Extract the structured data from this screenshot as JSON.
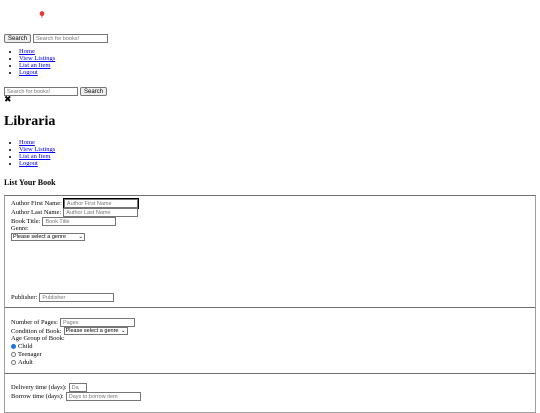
{
  "header": {
    "search_button": "Search",
    "search_placeholder": "Search for books!"
  },
  "nav": {
    "home": "Home",
    "view_listings": "View Listings",
    "list_item": "List an Item",
    "logout": "Logout"
  },
  "brand": "Libraria",
  "form": {
    "title": "List Your Book",
    "author_first_label": "Author First Name:",
    "author_first_placeholder": "Author First Name",
    "author_last_label": "Author Last Name:",
    "author_last_placeholder": "Author Last Name",
    "book_title_label": "Book Title:",
    "book_title_placeholder": "Book Title",
    "genre_label": "Genre:",
    "genre_selected": "Please select a genre",
    "publisher_label": "Publisher:",
    "publisher_placeholder": "Publisher",
    "pages_label": "Number of Pages:",
    "pages_placeholder": "Pages",
    "condition_label": "Condition of Book:",
    "condition_selected": "Please select a genre",
    "age_group_label": "Age Group of Book:",
    "age_groups": [
      "Child",
      "Teenager",
      "Adult"
    ],
    "age_group_selected": "Child",
    "delivery_label": "Delivery time (days):",
    "delivery_placeholder": "Da",
    "borrow_label": "Borrow time (days):",
    "borrow_placeholder": "Days to borrow item"
  },
  "colors": {
    "link": "#0000ee",
    "logo_balloon": "#e53935",
    "radio_accent": "#1a73e8"
  }
}
